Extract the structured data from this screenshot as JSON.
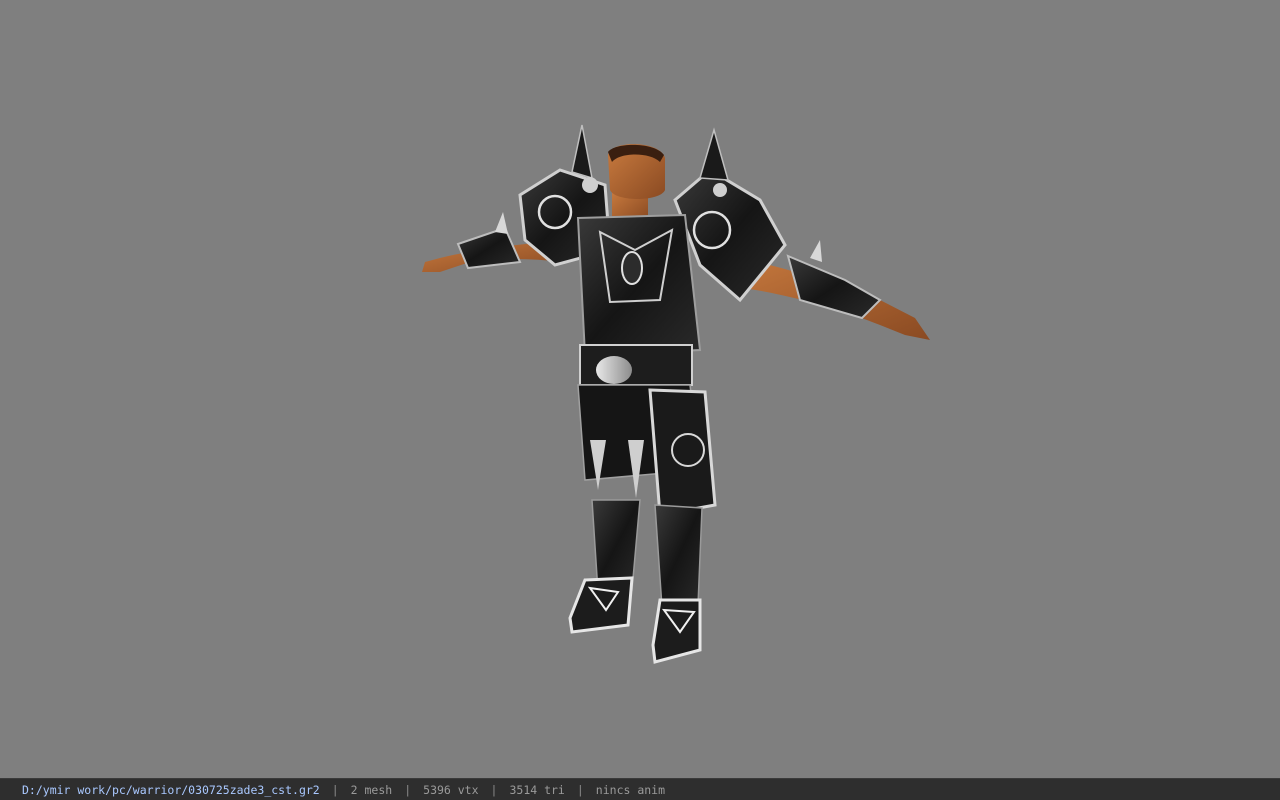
{
  "status_bar": {
    "file_path": "D:/ymir work/pc/warrior/030725zade3_cst.gr2",
    "separator": "|",
    "mesh": "2 mesh",
    "vertices": "5396 vtx",
    "triangles": "3514 tri",
    "animation": "nincs anim"
  },
  "colors": {
    "viewport_background": "#7f7f7f",
    "status_bar_background": "#2e2e2e",
    "path_text": "#a9c8ff",
    "info_text": "#9a9a9a"
  }
}
